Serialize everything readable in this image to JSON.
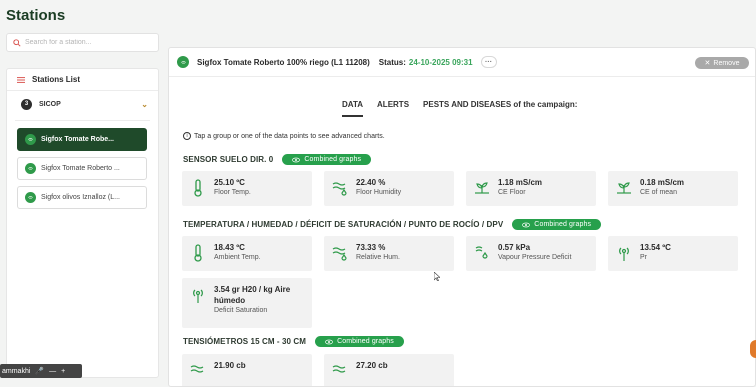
{
  "page_title": "Stations",
  "search": {
    "placeholder": "Search for a station..."
  },
  "list": {
    "header": "Stations List",
    "group": {
      "count": "3",
      "name": "SICOP"
    },
    "stations": [
      {
        "label": "Sigfox Tomate Robe...",
        "active": true
      },
      {
        "label": "Sigfox Tomate Roberto ...",
        "active": false
      },
      {
        "label": "Sigfox olivos Iznalloz (L...",
        "active": false
      }
    ]
  },
  "status_bar": {
    "user": "ammakhi"
  },
  "main": {
    "station_name": "Sigfox Tomate Roberto 100% riego (L1 11208)",
    "status_label": "Status:",
    "status_date": "24-10-2025 09:31",
    "more_label": "···",
    "remove_label": "Remove",
    "tabs": [
      "DATA",
      "ALERTS",
      "PESTS AND DISEASES of the campaign:"
    ],
    "hint": "Tap a group or one of the data points to see advanced charts.",
    "combined_label": "Combined graphs",
    "sections": [
      {
        "title": "SENSOR SUELO DIR. 0",
        "cards": [
          {
            "icon": "thermometer-icon",
            "value": "25.10 ºC",
            "label": "Floor Temp."
          },
          {
            "icon": "humidity-icon",
            "value": "22.40 %",
            "label": "Floor Humidity"
          },
          {
            "icon": "plant-icon",
            "value": "1.18 mS/cm",
            "label": "CE Floor"
          },
          {
            "icon": "plant-icon",
            "value": "0.18 mS/cm",
            "label": "CE of mean"
          }
        ]
      },
      {
        "title": "TEMPERATURA / HUMEDAD / DÉFICIT DE SATURACIÓN / PUNTO DE ROCÍO / DPV",
        "cards": [
          {
            "icon": "thermometer-icon",
            "value": "18.43 ºC",
            "label": "Ambient Temp."
          },
          {
            "icon": "humidity-icon",
            "value": "73.33 %",
            "label": "Relative Hum."
          },
          {
            "icon": "vapour-icon",
            "value": "0.57 kPa",
            "label": "Vapour Pressure Deficit"
          },
          {
            "icon": "antenna-icon",
            "value": "13.54 ºC",
            "label": "Pr"
          },
          {
            "icon": "antenna-icon",
            "value": "3.54 gr H20 / kg Aire húmedo",
            "label": "Deficit Saturation"
          }
        ]
      },
      {
        "title": "TENSIÓMETROS 15 CM - 30 CM",
        "cards": [
          {
            "icon": "humidity-icon",
            "value": "21.90 cb",
            "label": ""
          },
          {
            "icon": "humidity-icon",
            "value": "27.20 cb",
            "label": ""
          }
        ]
      }
    ]
  },
  "colors": {
    "brand_dark": "#1f4a2a",
    "accent_green": "#27a04c",
    "status_date": "#3aa55c"
  }
}
